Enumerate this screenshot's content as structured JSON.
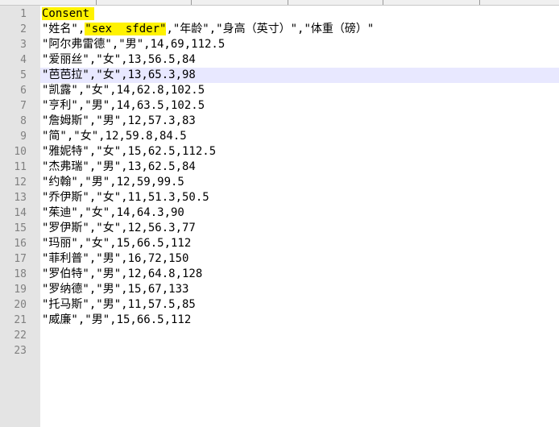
{
  "editor": {
    "current_line": 5,
    "highlight_color": "#fff200",
    "current_line_color": "#e8e8ff",
    "lines": [
      {
        "number": "1",
        "text": "Consent"
      },
      {
        "number": "2",
        "pre": "\"姓名\",",
        "hl": "\"sex  sfder\"",
        "post": ",\"年龄\",\"身高（英寸）\",\"体重（磅）\""
      },
      {
        "number": "3",
        "text": "\"阿尔弗雷德\",\"男\",14,69,112.5"
      },
      {
        "number": "4",
        "text": "\"爱丽丝\",\"女\",13,56.5,84"
      },
      {
        "number": "5",
        "text": "\"芭芭拉\",\"女\",13,65.3,98"
      },
      {
        "number": "6",
        "text": "\"凯露\",\"女\",14,62.8,102.5"
      },
      {
        "number": "7",
        "text": "\"亨利\",\"男\",14,63.5,102.5"
      },
      {
        "number": "8",
        "text": "\"詹姆斯\",\"男\",12,57.3,83"
      },
      {
        "number": "9",
        "text": "\"简\",\"女\",12,59.8,84.5"
      },
      {
        "number": "10",
        "text": "\"雅妮特\",\"女\",15,62.5,112.5"
      },
      {
        "number": "11",
        "text": "\"杰弗瑞\",\"男\",13,62.5,84"
      },
      {
        "number": "12",
        "text": "\"约翰\",\"男\",12,59,99.5"
      },
      {
        "number": "13",
        "text": "\"乔伊斯\",\"女\",11,51.3,50.5"
      },
      {
        "number": "14",
        "text": "\"茱迪\",\"女\",14,64.3,90"
      },
      {
        "number": "15",
        "text": "\"罗伊斯\",\"女\",12,56.3,77"
      },
      {
        "number": "16",
        "text": "\"玛丽\",\"女\",15,66.5,112"
      },
      {
        "number": "17",
        "text": "\"菲利普\",\"男\",16,72,150"
      },
      {
        "number": "18",
        "text": "\"罗伯特\",\"男\",12,64.8,128"
      },
      {
        "number": "19",
        "text": "\"罗纳德\",\"男\",15,67,133"
      },
      {
        "number": "20",
        "text": "\"托马斯\",\"男\",11,57.5,85"
      },
      {
        "number": "21",
        "text": "\"威廉\",\"男\",15,66.5,112"
      },
      {
        "number": "22",
        "text": ""
      },
      {
        "number": "23",
        "text": ""
      }
    ]
  }
}
